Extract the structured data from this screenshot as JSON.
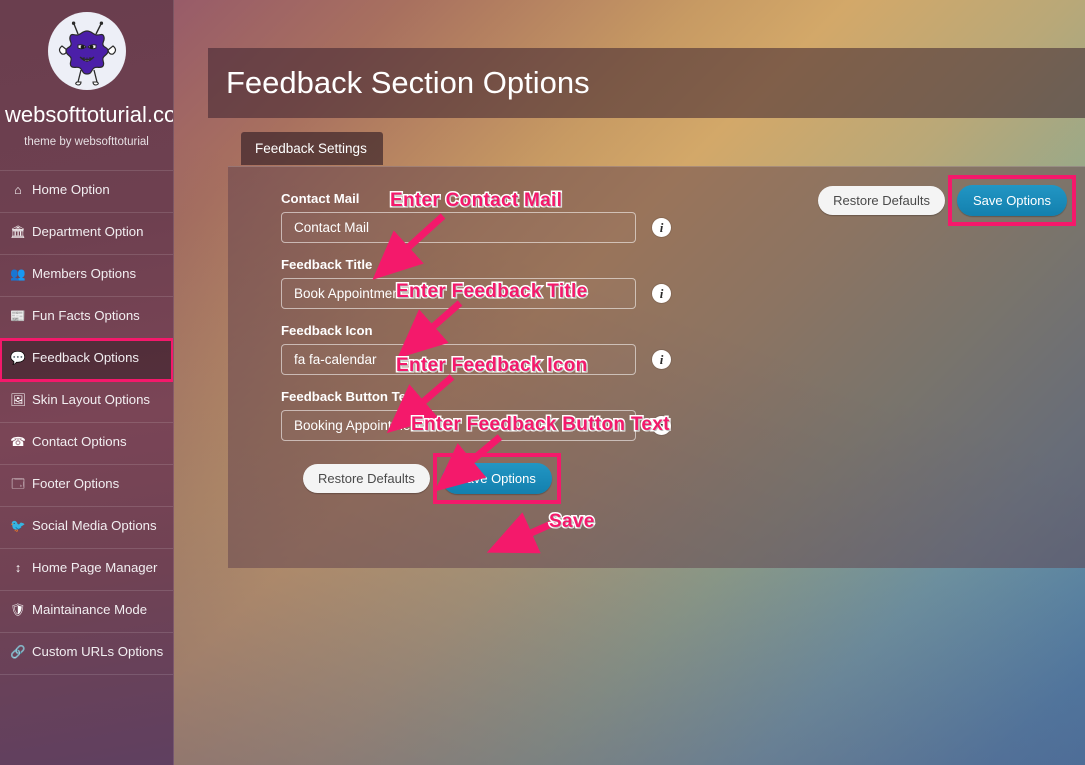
{
  "brand": {
    "logo_icon": "monster-bug-logo",
    "title": "websofttoturial.com",
    "subtitle": "theme by websofttoturial"
  },
  "sidebar": {
    "items": [
      {
        "label": "Home Option",
        "icon": "home-icon",
        "glyph": "⌂",
        "active": false
      },
      {
        "label": "Department Option",
        "icon": "bank-icon",
        "glyph": "🏛",
        "active": false
      },
      {
        "label": "Members Options",
        "icon": "users-icon",
        "glyph": "👥",
        "active": false
      },
      {
        "label": "Fun Facts Options",
        "icon": "newspaper-icon",
        "glyph": "📰",
        "active": false
      },
      {
        "label": "Feedback Options",
        "icon": "comments-icon",
        "glyph": "💬",
        "active": true
      },
      {
        "label": "Skin Layout Options",
        "icon": "image-icon",
        "glyph": "🖼",
        "active": false
      },
      {
        "label": "Contact Options",
        "icon": "phone-icon",
        "glyph": "☎",
        "active": false
      },
      {
        "label": "Footer Options",
        "icon": "window-icon",
        "glyph": "🗔",
        "active": false
      },
      {
        "label": "Social Media Options",
        "icon": "twitter-icon",
        "glyph": "🐦",
        "active": false
      },
      {
        "label": "Home Page Manager",
        "icon": "sort-icon",
        "glyph": "↕",
        "active": false
      },
      {
        "label": "Maintainance Mode",
        "icon": "shield-icon",
        "glyph": "🛡",
        "active": false
      },
      {
        "label": "Custom URLs Options",
        "icon": "link-icon",
        "glyph": "🔗",
        "active": false
      }
    ]
  },
  "page": {
    "title": "Feedback Section Options"
  },
  "tabs": [
    {
      "label": "Feedback Settings",
      "active": true
    }
  ],
  "toolbar_top": {
    "restore_label": "Restore Defaults",
    "save_label": "Save Options"
  },
  "toolbar_bottom": {
    "restore_label": "Restore Defaults",
    "save_label": "Save Options"
  },
  "fields": [
    {
      "label": "Contact Mail",
      "value": "Contact Mail",
      "placeholder": "Contact Mail",
      "info_icon": "info-icon"
    },
    {
      "label": "Feedback Title",
      "value": "Book Appointment",
      "placeholder": "Feedback Title",
      "info_icon": "info-icon"
    },
    {
      "label": "Feedback Icon",
      "value": "fa fa-calendar",
      "placeholder": "Feedback Icon",
      "info_icon": "info-icon"
    },
    {
      "label": "Feedback Button Text",
      "value": "Booking Appointment",
      "placeholder": "Feedback Button Text",
      "info_icon": "info-icon"
    }
  ],
  "annotations": [
    {
      "text": "Enter Contact Mail"
    },
    {
      "text": "Enter Feedback Title"
    },
    {
      "text": "Enter Feedback Icon"
    },
    {
      "text": "Enter Feedback Button Text"
    },
    {
      "text": "Save"
    }
  ],
  "colors": {
    "annotation_pink": "#f4196b",
    "save_button_blue": "#1380ae",
    "sidebar_plum": "#6e4050",
    "logo_purple": "#4b1fa8"
  }
}
